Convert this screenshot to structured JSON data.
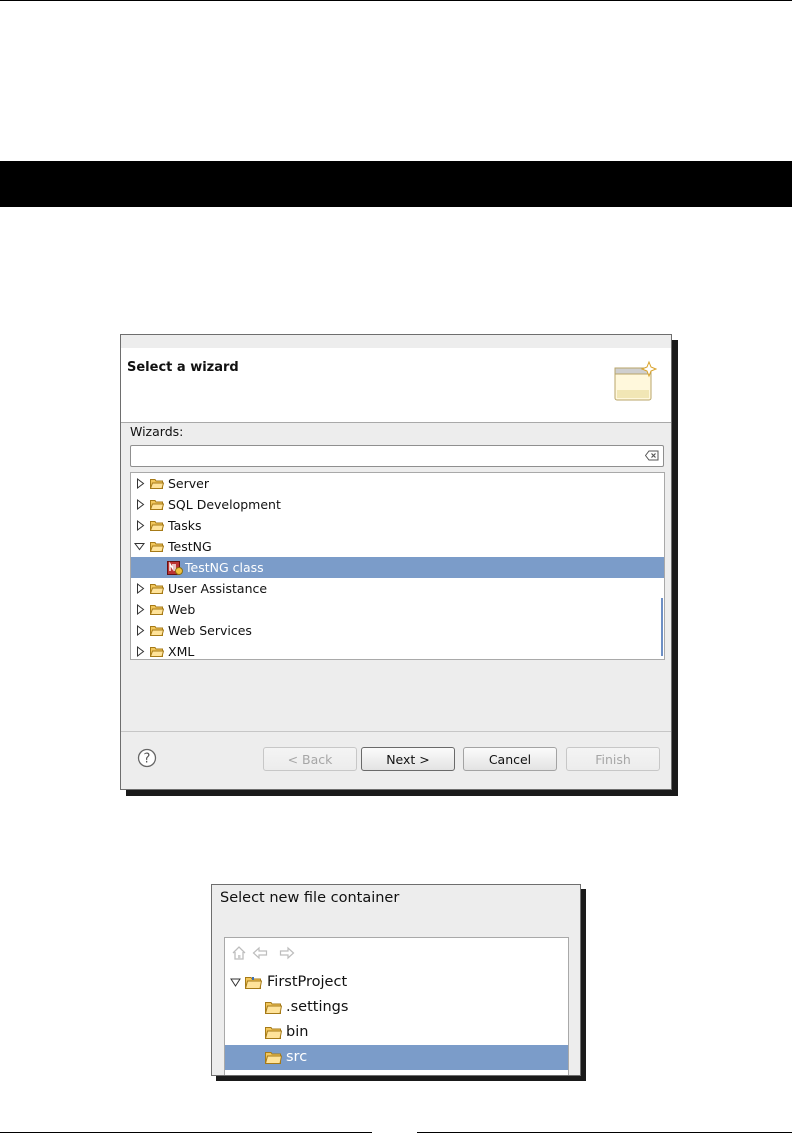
{
  "wizard_dialog": {
    "title": "Select a wizard",
    "wizards_label": "Wizards:",
    "filter": {
      "value": "",
      "placeholder": ""
    },
    "tree": [
      {
        "label": "Server",
        "expanded": false,
        "selected": false
      },
      {
        "label": "SQL Development",
        "expanded": false,
        "selected": false
      },
      {
        "label": "Tasks",
        "expanded": false,
        "selected": false
      },
      {
        "label": "TestNG",
        "expanded": true,
        "selected": false
      },
      {
        "label": "TestNG class",
        "child": true,
        "selected": true
      },
      {
        "label": "User Assistance",
        "expanded": false,
        "selected": false
      },
      {
        "label": "Web",
        "expanded": false,
        "selected": false
      },
      {
        "label": "Web Services",
        "expanded": false,
        "selected": false
      },
      {
        "label": "XML",
        "expanded": false,
        "selected": false
      }
    ],
    "buttons": {
      "back": "< Back",
      "next": "Next >",
      "cancel": "Cancel",
      "finish": "Finish"
    }
  },
  "file_container_panel": {
    "title": "Select new file container",
    "tree": [
      {
        "label": "FirstProject",
        "expanded": true,
        "selected": false
      },
      {
        "label": ".settings",
        "selected": false
      },
      {
        "label": "bin",
        "selected": false
      },
      {
        "label": "src",
        "selected": true
      }
    ]
  },
  "colors": {
    "selection": "#7b9cc9",
    "dialog_bg": "#ededed",
    "folder": "#e8b84a"
  }
}
